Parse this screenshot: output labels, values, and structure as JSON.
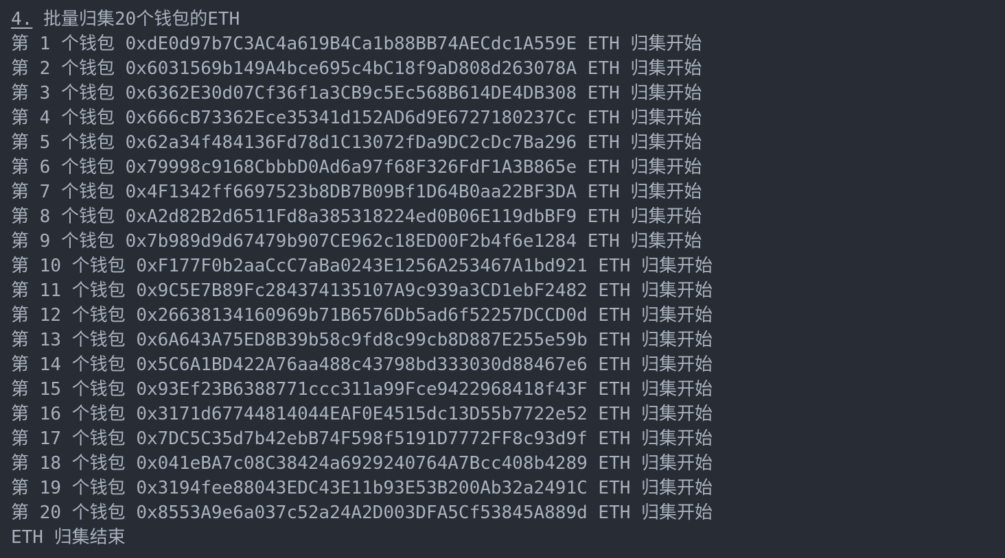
{
  "title": {
    "number": "4.",
    "text": "批量归集20个钱包的ETH"
  },
  "rows": [
    {
      "prefix": "第",
      "index": "1",
      "unit": "个钱包",
      "address": "0xdE0d97b7C3AC4a619B4Ca1b88BB74AECdc1A559E",
      "token": "ETH",
      "status": "归集开始"
    },
    {
      "prefix": "第",
      "index": "2",
      "unit": "个钱包",
      "address": "0x6031569b149A4bce695c4bC18f9aD808d263078A",
      "token": "ETH",
      "status": "归集开始"
    },
    {
      "prefix": "第",
      "index": "3",
      "unit": "个钱包",
      "address": "0x6362E30d07Cf36f1a3CB9c5Ec568B614DE4DB308",
      "token": "ETH",
      "status": "归集开始"
    },
    {
      "prefix": "第",
      "index": "4",
      "unit": "个钱包",
      "address": "0x666cB73362Ece35341d152AD6d9E6727180237Cc",
      "token": "ETH",
      "status": "归集开始"
    },
    {
      "prefix": "第",
      "index": "5",
      "unit": "个钱包",
      "address": "0x62a34f484136Fd78d1C13072fDa9DC2cDc7Ba296",
      "token": "ETH",
      "status": "归集开始"
    },
    {
      "prefix": "第",
      "index": "6",
      "unit": "个钱包",
      "address": "0x79998c9168CbbbD0Ad6a97f68F326FdF1A3B865e",
      "token": "ETH",
      "status": "归集开始"
    },
    {
      "prefix": "第",
      "index": "7",
      "unit": "个钱包",
      "address": "0x4F1342ff6697523b8DB7B09Bf1D64B0aa22BF3DA",
      "token": "ETH",
      "status": "归集开始"
    },
    {
      "prefix": "第",
      "index": "8",
      "unit": "个钱包",
      "address": "0xA2d82B2d6511Fd8a385318224ed0B06E119dbBF9",
      "token": "ETH",
      "status": "归集开始"
    },
    {
      "prefix": "第",
      "index": "9",
      "unit": "个钱包",
      "address": "0x7b989d9d67479b907CE962c18ED00F2b4f6e1284",
      "token": "ETH",
      "status": "归集开始"
    },
    {
      "prefix": "第",
      "index": "10",
      "unit": "个钱包",
      "address": "0xF177F0b2aaCcC7aBa0243E1256A253467A1bd921",
      "token": "ETH",
      "status": "归集开始"
    },
    {
      "prefix": "第",
      "index": "11",
      "unit": "个钱包",
      "address": "0x9C5E7B89Fc284374135107A9c939a3CD1ebF2482",
      "token": "ETH",
      "status": "归集开始"
    },
    {
      "prefix": "第",
      "index": "12",
      "unit": "个钱包",
      "address": "0x26638134160969b71B6576Db5ad6f52257DCCD0d",
      "token": "ETH",
      "status": "归集开始"
    },
    {
      "prefix": "第",
      "index": "13",
      "unit": "个钱包",
      "address": "0x6A643A75ED8B39b58c9fd8c99cb8D887E255e59b",
      "token": "ETH",
      "status": "归集开始"
    },
    {
      "prefix": "第",
      "index": "14",
      "unit": "个钱包",
      "address": "0x5C6A1BD422A76aa488c43798bd333030d88467e6",
      "token": "ETH",
      "status": "归集开始"
    },
    {
      "prefix": "第",
      "index": "15",
      "unit": "个钱包",
      "address": "0x93Ef23B6388771ccc311a99Fce9422968418f43F",
      "token": "ETH",
      "status": "归集开始"
    },
    {
      "prefix": "第",
      "index": "16",
      "unit": "个钱包",
      "address": "0x3171d67744814044EAF0E4515dc13D55b7722e52",
      "token": "ETH",
      "status": "归集开始"
    },
    {
      "prefix": "第",
      "index": "17",
      "unit": "个钱包",
      "address": "0x7DC5C35d7b42ebB74F598f5191D7772FF8c93d9f",
      "token": "ETH",
      "status": "归集开始"
    },
    {
      "prefix": "第",
      "index": "18",
      "unit": "个钱包",
      "address": "0x041eBA7c08C38424a6929240764A7Bcc408b4289",
      "token": "ETH",
      "status": "归集开始"
    },
    {
      "prefix": "第",
      "index": "19",
      "unit": "个钱包",
      "address": "0x3194fee88043EDC43E11b93E53B200Ab32a2491C",
      "token": "ETH",
      "status": "归集开始"
    },
    {
      "prefix": "第",
      "index": "20",
      "unit": "个钱包",
      "address": "0x8553A9e6a037c52a24A2D003DFA5Cf53845A889d",
      "token": "ETH",
      "status": "归集开始"
    }
  ],
  "footer": {
    "token": "ETH",
    "status": "归集结束"
  },
  "colors": {
    "background": "#282c34",
    "text": "#aab1be"
  }
}
